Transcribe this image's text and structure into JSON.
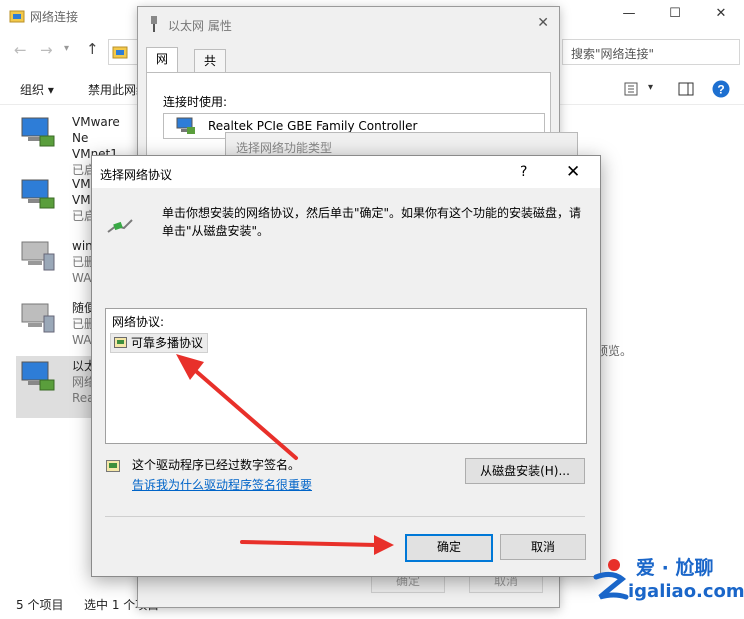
{
  "background_window": {
    "title": "网络连接",
    "search_placeholder": "搜索\"网络连接\"",
    "toolbar": {
      "organize": "组织 ▾",
      "disable": "禁用此网络"
    },
    "items": [
      {
        "line1": "VMware Ne",
        "line2": "VMnet1",
        "line3": "已启用"
      },
      {
        "line1": "VM",
        "line2": "VM",
        "line3": "已启"
      },
      {
        "line1": "win",
        "line2": "已删",
        "line3": "WA"
      },
      {
        "line1": "随便",
        "line2": "已删",
        "line3": "WA"
      },
      {
        "line1": "以太",
        "line2": "网络",
        "line3": "Rea"
      }
    ],
    "status_count": "5 个项目",
    "status_selected": "选中 1 个项目",
    "preview_text": "预览。"
  },
  "properties_dialog": {
    "title": "以太网 属性",
    "tabs": [
      "网络",
      "共享"
    ],
    "connect_using_label": "连接时使用:",
    "adapter_name": "Realtek PCIe GBE Family Controller",
    "ok_label": "确定",
    "cancel_label": "取消"
  },
  "feature_type_dialog": {
    "title": "选择网络功能类型"
  },
  "protocol_dialog": {
    "title": "选择网络协议",
    "help_glyph": "?",
    "close_glyph": "✕",
    "instruction": "单击你想安装的网络协议，然后单击\"确定\"。如果你有这个功能的安装磁盘，请单击\"从磁盘安装\"。",
    "list_label": "网络协议:",
    "protocols": [
      "可靠多播协议"
    ],
    "signed_text": "这个驱动程序已经过数字签名。",
    "signing_link": "告诉我为什么驱动程序签名很重要",
    "disk_button": "从磁盘安装(H)...",
    "ok_button": "确定",
    "cancel_button": "取消"
  },
  "watermark": {
    "line1": "爱 · 尬聊",
    "line2": "igaliao.com"
  },
  "colors": {
    "accent": "#0078d7",
    "link": "#0064c8",
    "arrow": "#e8302a",
    "logo_blue": "#1a66c9",
    "logo_red": "#e8302a"
  }
}
